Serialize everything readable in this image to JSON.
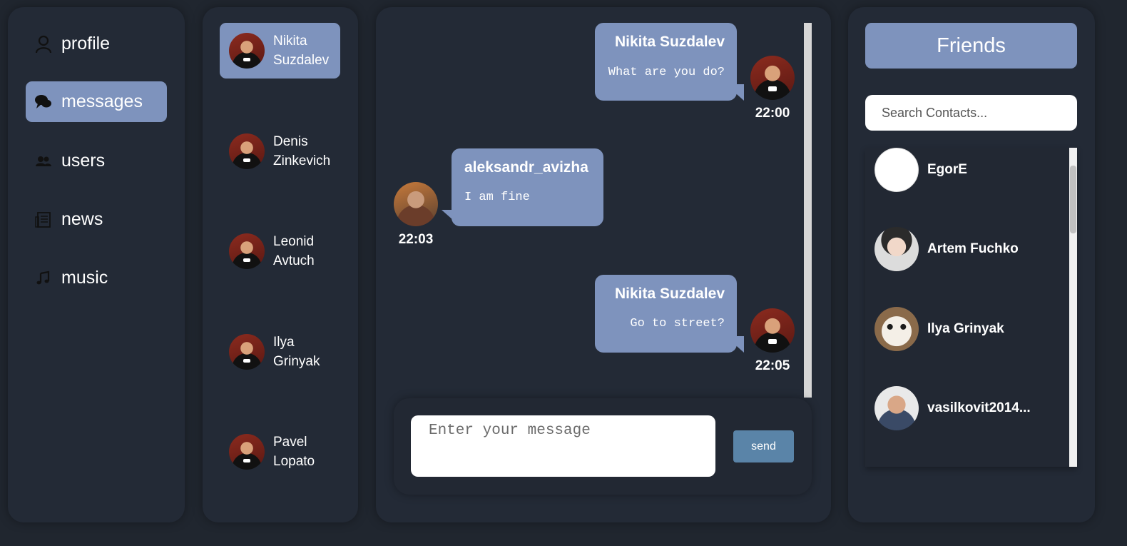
{
  "nav": {
    "items": [
      {
        "label": "profile",
        "icon": "user-icon",
        "active": false
      },
      {
        "label": "messages",
        "icon": "chat-bubbles-icon",
        "active": true
      },
      {
        "label": "users",
        "icon": "users-icon",
        "active": false
      },
      {
        "label": "news",
        "icon": "newspaper-icon",
        "active": false
      },
      {
        "label": "music",
        "icon": "music-note-icon",
        "active": false
      }
    ]
  },
  "dialogs": [
    {
      "first": "Nikita",
      "last": "Suzdalev",
      "active": true
    },
    {
      "first": "Denis",
      "last": "Zinkevich",
      "active": false
    },
    {
      "first": "Leonid",
      "last": "Avtuch",
      "active": false
    },
    {
      "first": "Ilya",
      "last": "Grinyak",
      "active": false
    },
    {
      "first": "Pavel",
      "last": "Lopato",
      "active": false
    }
  ],
  "chat": {
    "messages": [
      {
        "author": "Nikita Suzdalev",
        "text": "What are you do?",
        "time": "22:00",
        "side": "right"
      },
      {
        "author": "aleksandr_avizha",
        "text": "I am fine",
        "time": "22:03",
        "side": "left"
      },
      {
        "author": "Nikita Suzdalev",
        "text": "Go to street?",
        "time": "22:05",
        "side": "right"
      }
    ],
    "input_placeholder": "Enter your message",
    "send_label": "send"
  },
  "friends": {
    "title": "Friends",
    "search_placeholder": "Search Contacts...",
    "contacts": [
      {
        "name": "EgorE"
      },
      {
        "name": "Artem Fuchko"
      },
      {
        "name": "Ilya Grinyak"
      },
      {
        "name": "vasilkovit2014..."
      }
    ]
  },
  "colors": {
    "background": "#20262f",
    "panel": "#232a36",
    "accent": "#7e93bd",
    "send_button": "#5a84a8"
  }
}
